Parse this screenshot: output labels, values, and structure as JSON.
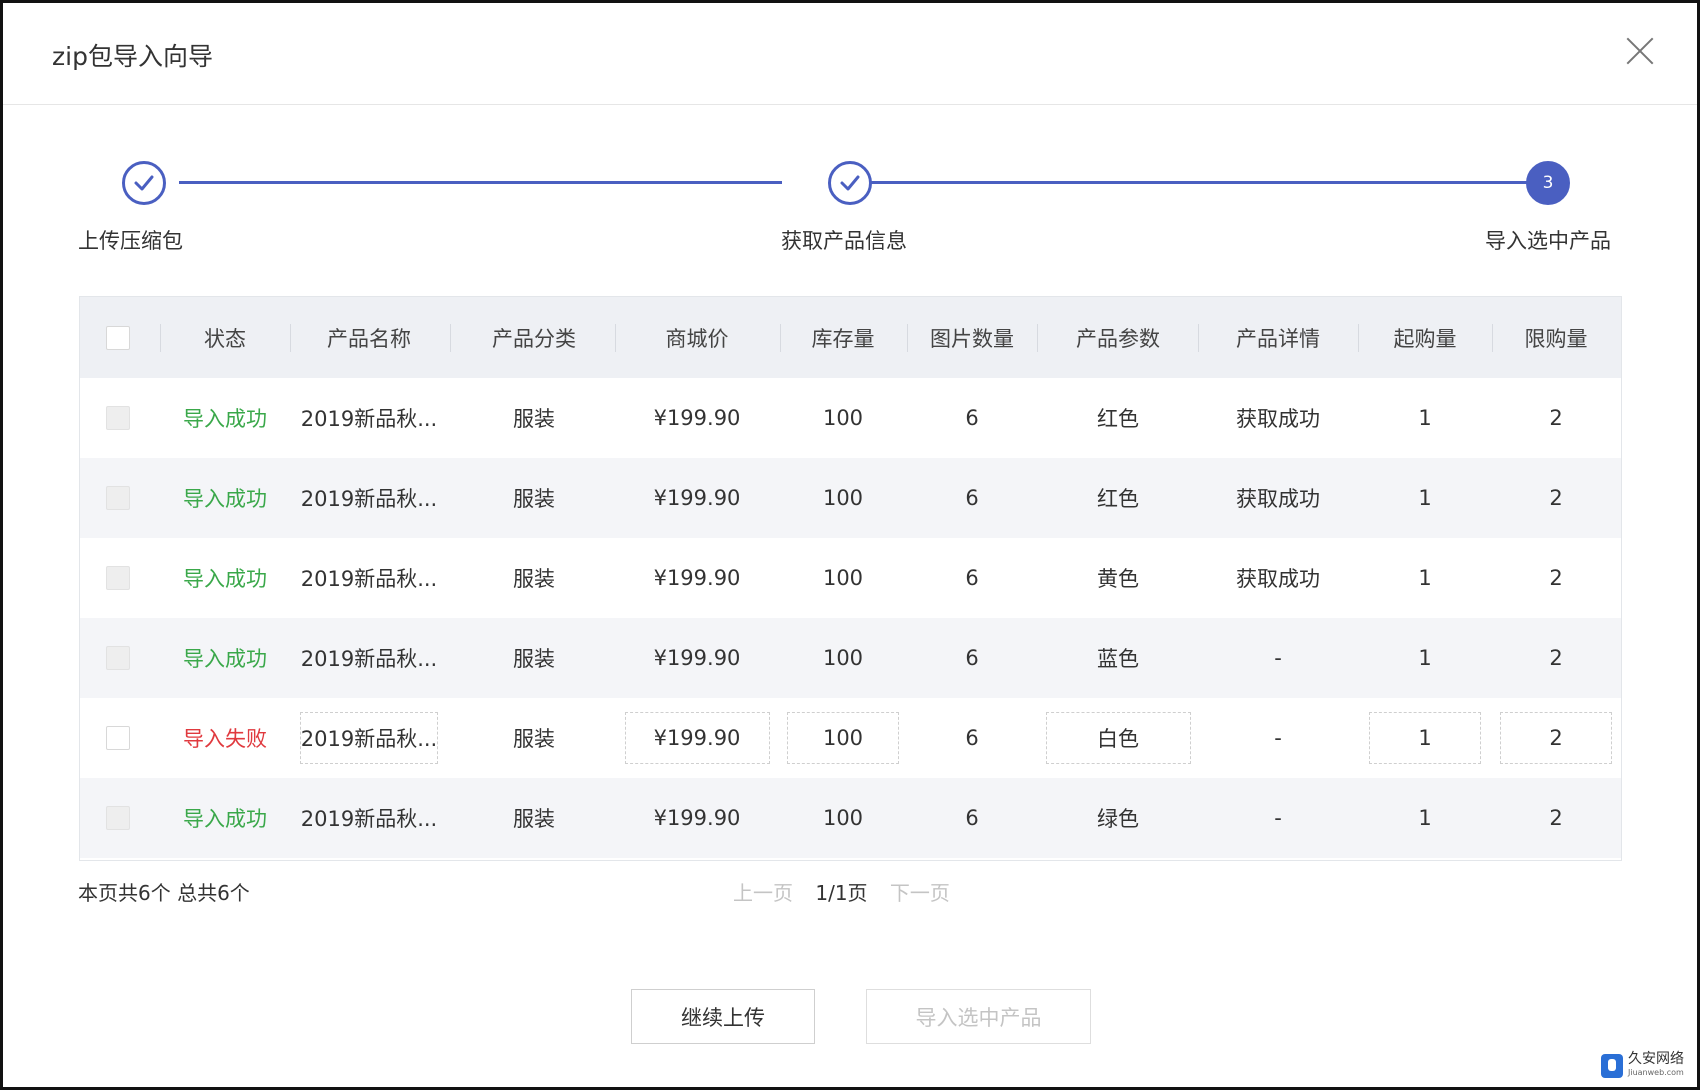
{
  "dialog": {
    "title": "zip包导入向导"
  },
  "steps": [
    {
      "label": "上传压缩包",
      "state": "done"
    },
    {
      "label": "获取产品信息",
      "state": "done"
    },
    {
      "label": "导入选中产品",
      "state": "active",
      "number": "3"
    }
  ],
  "table": {
    "headers": [
      "状态",
      "产品名称",
      "产品分类",
      "商城价",
      "库存量",
      "图片数量",
      "产品参数",
      "产品详情",
      "起购量",
      "限购量"
    ],
    "rows": [
      {
        "status": "导入成功",
        "status_type": "success",
        "name": "2019新品秋...",
        "category": "服装",
        "price": "¥199.90",
        "stock": "100",
        "images": "6",
        "params": "红色",
        "detail": "获取成功",
        "min": "1",
        "max": "2"
      },
      {
        "status": "导入成功",
        "status_type": "success",
        "name": "2019新品秋...",
        "category": "服装",
        "price": "¥199.90",
        "stock": "100",
        "images": "6",
        "params": "红色",
        "detail": "获取成功",
        "min": "1",
        "max": "2"
      },
      {
        "status": "导入成功",
        "status_type": "success",
        "name": "2019新品秋...",
        "category": "服装",
        "price": "¥199.90",
        "stock": "100",
        "images": "6",
        "params": "黄色",
        "detail": "获取成功",
        "min": "1",
        "max": "2"
      },
      {
        "status": "导入成功",
        "status_type": "success",
        "name": "2019新品秋...",
        "category": "服装",
        "price": "¥199.90",
        "stock": "100",
        "images": "6",
        "params": "蓝色",
        "detail": "-",
        "min": "1",
        "max": "2"
      },
      {
        "status": "导入失败",
        "status_type": "fail",
        "name": "2019新品秋...",
        "category": "服装",
        "price": "¥199.90",
        "stock": "100",
        "images": "6",
        "params": "白色",
        "detail": "-",
        "min": "1",
        "max": "2"
      },
      {
        "status": "导入成功",
        "status_type": "success",
        "name": "2019新品秋...",
        "category": "服装",
        "price": "¥199.90",
        "stock": "100",
        "images": "6",
        "params": "绿色",
        "detail": "-",
        "min": "1",
        "max": "2"
      }
    ]
  },
  "pagination": {
    "summary": "本页共6个  总共6个",
    "prev": "上一页",
    "current": "1/1页",
    "next": "下一页"
  },
  "buttons": {
    "continue": "继续上传",
    "import": "导入选中产品"
  },
  "watermark": {
    "text": "久安网络",
    "sub": "Jiuanweb.com"
  },
  "colors": {
    "accent": "#4a5fc1",
    "success": "#3aa84a",
    "fail": "#e0393e",
    "disabled": "#c4c4c4"
  }
}
